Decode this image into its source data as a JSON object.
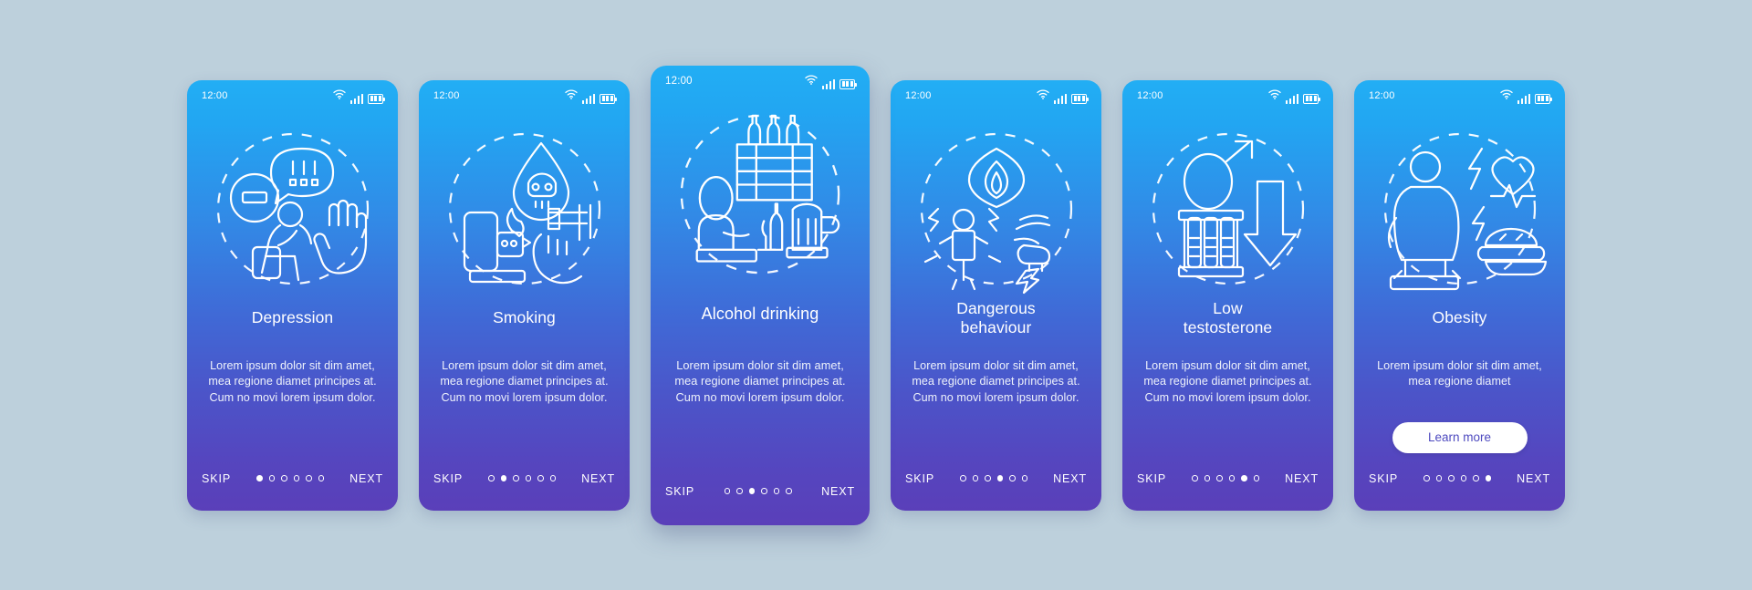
{
  "page": {
    "background_color": "#bdd0dc",
    "card_gradient_from": "#22aef4",
    "card_gradient_to": "#5a3fb9",
    "accent_text_color": "#ffffff",
    "button_text_color": "#4d49bf"
  },
  "statusbar": {
    "time": "12:00",
    "icons": [
      "wifi-icon",
      "signal-icon",
      "battery-icon"
    ]
  },
  "footer": {
    "skip_label": "SKIP",
    "next_label": "NEXT",
    "dot_count": 6
  },
  "cards": [
    {
      "id": "depression",
      "title": "Depression",
      "title_lines": [
        "Depression"
      ],
      "description": "Lorem ipsum dolor sit dim amet, mea regione diamet principes at. Cum no movi lorem ipsum dolor.",
      "active_dot": 1,
      "featured": false,
      "cta": null,
      "illustration": "depression-illustration",
      "illustration_parts": [
        "minus-sign-circle-icon",
        "speech-bubble-exclamations-icon",
        "sad-seated-person-icon",
        "raised-hand-icon",
        "dashed-circle-icon"
      ]
    },
    {
      "id": "smoking",
      "title": "Smoking",
      "title_lines": [
        "Smoking"
      ],
      "description": "Lorem ipsum dolor sit dim amet, mea regione diamet principes at. Cum no movi lorem ipsum dolor.",
      "active_dot": 2,
      "featured": false,
      "cta": null,
      "illustration": "smoking-illustration",
      "illustration_parts": [
        "skull-in-droplet-icon",
        "lighter-flame-icon",
        "cigarettes-in-hand-icon",
        "dashed-circle-icon"
      ]
    },
    {
      "id": "alcohol-drinking",
      "title": "Alcohol drinking",
      "title_lines": [
        "Alcohol drinking"
      ],
      "description": "Lorem ipsum dolor sit dim amet, mea regione diamet principes at. Cum no movi lorem ipsum dolor.",
      "active_dot": 3,
      "featured": true,
      "cta": null,
      "illustration": "alcohol-drinking-illustration",
      "illustration_parts": [
        "bottle-crate-icon",
        "drunk-person-at-bar-icon",
        "beer-mug-icon",
        "dashed-circle-icon"
      ]
    },
    {
      "id": "dangerous-behaviour",
      "title": "Dangerous behaviour",
      "title_lines": [
        "Dangerous",
        "behaviour"
      ],
      "description": "Lorem ipsum dolor sit dim amet, mea regione diamet principes at. Cum no movi lorem ipsum dolor.",
      "active_dot": 4,
      "featured": false,
      "cta": null,
      "illustration": "dangerous-behaviour-illustration",
      "illustration_parts": [
        "flaming-eye-icon",
        "angry-person-lightning-icon",
        "punching-fist-icon",
        "dashed-circle-icon"
      ]
    },
    {
      "id": "low-testosterone",
      "title": "Low testosterone",
      "title_lines": [
        "Low",
        "testosterone"
      ],
      "description": "Lorem ipsum dolor sit dim amet, mea regione diamet principes at. Cum no movi lorem ipsum dolor.",
      "active_dot": 5,
      "featured": false,
      "cta": null,
      "illustration": "low-testosterone-illustration",
      "illustration_parts": [
        "male-gender-symbol-icon",
        "test-tube-rack-icon",
        "down-arrow-icon",
        "dashed-circle-icon"
      ]
    },
    {
      "id": "obesity",
      "title": "Obesity",
      "title_lines": [
        "Obesity"
      ],
      "description": "Lorem ipsum dolor sit dim amet, mea regione diamet",
      "active_dot": 6,
      "featured": false,
      "cta": "Learn more",
      "illustration": "obesity-illustration",
      "illustration_parts": [
        "overweight-person-on-scale-icon",
        "heartbeat-icon",
        "burger-icon",
        "dashed-circle-icon"
      ]
    }
  ]
}
